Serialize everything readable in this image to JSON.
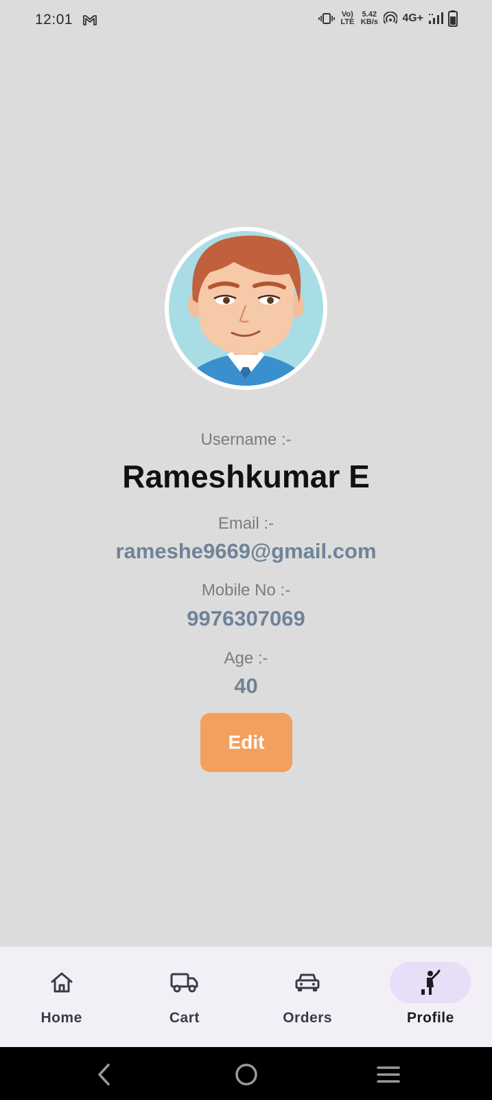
{
  "status_bar": {
    "time": "12:01",
    "volte": "Vo) LTE",
    "speed_value": "5.42",
    "speed_unit": "KB/s",
    "network": "4G+"
  },
  "profile": {
    "username_label": "Username :-",
    "username": "Rameshkumar E",
    "email_label": "Email :-",
    "email": "rameshe9669@gmail.com",
    "mobile_label": "Mobile No :-",
    "mobile": "9976307069",
    "age_label": "Age :-",
    "age": "40"
  },
  "edit_button": {
    "label": "Edit"
  },
  "bottom_nav": {
    "items": [
      {
        "label": "Home",
        "icon": "home-icon",
        "active": false
      },
      {
        "label": "Cart",
        "icon": "truck-icon",
        "active": false
      },
      {
        "label": "Orders",
        "icon": "car-icon",
        "active": false
      },
      {
        "label": "Profile",
        "icon": "person-waving-icon",
        "active": true
      }
    ]
  },
  "colors": {
    "background": "#dcdcdc",
    "edit_button": "#f3a05e",
    "value_text": "#6f8399",
    "nav_background": "#f3eff6",
    "nav_active_indicator": "#e7def7"
  }
}
